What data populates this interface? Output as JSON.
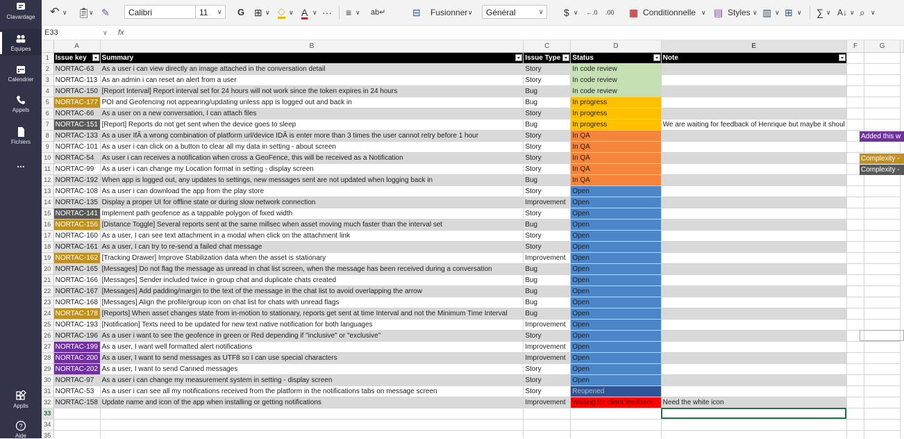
{
  "rail": {
    "items": [
      {
        "label": "Clavardage",
        "icon": "chat-icon"
      },
      {
        "label": "Équipes",
        "icon": "teams-icon"
      },
      {
        "label": "Calendrier",
        "icon": "calendar-icon"
      },
      {
        "label": "Appels",
        "icon": "phone-icon"
      },
      {
        "label": "Fichiers",
        "icon": "files-icon"
      },
      {
        "label": "...",
        "icon": "more-icon"
      },
      {
        "label": "Applis",
        "icon": "apps-icon"
      },
      {
        "label": "Aide",
        "icon": "help-icon"
      }
    ]
  },
  "ribbon": {
    "font_name": "Calibri",
    "font_size": "11",
    "bold": "G",
    "merge": "Fusionner",
    "number_format": "Général",
    "currency": "$",
    "dec_inc": "←.0",
    "dec_dec": ".00",
    "conditional": "Conditionnelle",
    "styles": "Styles",
    "more": "···"
  },
  "formula_bar": {
    "cell_ref": "E33",
    "fx": "fx",
    "value": ""
  },
  "columns": [
    "A",
    "B",
    "C",
    "D",
    "E",
    "F",
    "G"
  ],
  "header": {
    "key": "Issue key",
    "summary": "Summary",
    "type": "Issue Type",
    "status": "Status",
    "note": "Note"
  },
  "rows": [
    {
      "n": "2",
      "key": "NORTAC-63",
      "summary": " As a user i can view directly an image attached in the conversation detail",
      "type": "Story",
      "status": "In code review",
      "note": ""
    },
    {
      "n": "3",
      "key": "NORTAC-113",
      "summary": "As an admin i can reset an alert from a user",
      "type": "Story",
      "status": "In code review",
      "note": ""
    },
    {
      "n": "4",
      "key": "NORTAC-150",
      "summary": "[Report Interval] Report interval set for 24 hours will not work since the token expires in 24 hours",
      "type": "Bug",
      "status": "In code review",
      "note": ""
    },
    {
      "n": "5",
      "key": "NORTAC-177",
      "summary": "POI and Geofencing not appearing/updating unless app is logged out and back in",
      "type": "Bug",
      "status": "In progress",
      "note": ""
    },
    {
      "n": "6",
      "key": "NORTAC-66",
      "summary": "As a user on a new conversation, I can attach files",
      "type": "Story",
      "status": "In progress",
      "note": ""
    },
    {
      "n": "7",
      "key": "NORTAC-151",
      "summary": "[Report] Reports do not get sent when the device goes to sleep",
      "type": "Bug",
      "status": "In progress",
      "note": "We are waiting for feedback of Henrique but maybe it shoul"
    },
    {
      "n": "8",
      "key": "NORTAC-133",
      "summary": "As a user IfÂ a wrong combination of platform url/device IDÂ is enter more than 3 times the user cannot retry before 1 hour",
      "type": "Story",
      "status": "In QA",
      "note": ""
    },
    {
      "n": "9",
      "key": "NORTAC-101",
      "summary": "As a user i can click on a button to clear all my data in setting - about screen",
      "type": "Story",
      "status": "In QA",
      "note": ""
    },
    {
      "n": "10",
      "key": "NORTAC-54",
      "summary": "As user i can receives a notification when cross a GeoFence, this will be received as a Notification",
      "type": "Story",
      "status": "In QA",
      "note": ""
    },
    {
      "n": "11",
      "key": "NORTAC-99",
      "summary": "As a user i can change my Location format in setting - display screen",
      "type": "Story",
      "status": "In QA",
      "note": ""
    },
    {
      "n": "12",
      "key": "NORTAC-192",
      "summary": "When app is logged out, any updates to settings, new messages sent are not updated when logging back in",
      "type": "Bug",
      "status": "In QA",
      "note": ""
    },
    {
      "n": "13",
      "key": "NORTAC-108",
      "summary": "As a user i can download the app from the play store",
      "type": "Story",
      "status": "Open",
      "note": ""
    },
    {
      "n": "14",
      "key": "NORTAC-135",
      "summary": "Display a proper UI for offline state or during slow network connection",
      "type": "Improvement",
      "status": "Open",
      "note": ""
    },
    {
      "n": "15",
      "key": "NORTAC-141",
      "summary": "Implement path geofence as a tappable polygon of fixed width",
      "type": "Story",
      "status": "Open",
      "note": ""
    },
    {
      "n": "16",
      "key": "NORTAC-156",
      "summary": "[Distance Toggle] Several reports sent at the same millsec when asset moving much faster than the interval set",
      "type": "Bug",
      "status": "Open",
      "note": ""
    },
    {
      "n": "17",
      "key": "NORTAC-160",
      "summary": "As a user, I can see text attachment in a modal when click on the attachment link",
      "type": "Story",
      "status": "Open",
      "note": ""
    },
    {
      "n": "18",
      "key": "NORTAC-161",
      "summary": "As a user, I can try to re-send a failed chat message",
      "type": "Story",
      "status": "Open",
      "note": ""
    },
    {
      "n": "19",
      "key": "NORTAC-162",
      "summary": "[Tracking Drawer] Improve Stabilization data when the asset is stationary",
      "type": "Improvement",
      "status": "Open",
      "note": ""
    },
    {
      "n": "20",
      "key": "NORTAC-165",
      "summary": "[Messages] Do not flag the message as unread in chat list screen, when the message has been received during a conversation",
      "type": "Bug",
      "status": "Open",
      "note": ""
    },
    {
      "n": "21",
      "key": "NORTAC-166",
      "summary": "[Messages] Sender included twice in group chat and duplicate chats created",
      "type": "Bug",
      "status": "Open",
      "note": ""
    },
    {
      "n": "22",
      "key": "NORTAC-167",
      "summary": "[Messages] Add padding/margin to the text of the message in the chat list to avoid overlapping the arrow",
      "type": "Bug",
      "status": "Open",
      "note": ""
    },
    {
      "n": "23",
      "key": "NORTAC-168",
      "summary": "[Messages] Align the profile/group icon on chat list for chats with unread flags",
      "type": "Bug",
      "status": "Open",
      "note": ""
    },
    {
      "n": "24",
      "key": "NORTAC-178",
      "summary": "[Reports] When asset changes state from in-motion to stationary, reports get sent at time Interval and not the Minimum Time Interval",
      "type": "Bug",
      "status": "Open",
      "note": ""
    },
    {
      "n": "25",
      "key": "NORTAC-193",
      "summary": "[Notification] Texts need to be updated for new text native notification for both languages",
      "type": "Improvement",
      "status": "Open",
      "note": ""
    },
    {
      "n": "26",
      "key": "NORTAC-196",
      "summary": "As a user i want to see the geofence in green or Red depending if \"inclusive\" or \"exclusive\"",
      "type": "Story",
      "status": "Open",
      "note": ""
    },
    {
      "n": "27",
      "key": "NORTAC-199",
      "summary": "As a user, I want well formatted alert notifications",
      "type": "Improvement",
      "status": "Open",
      "note": ""
    },
    {
      "n": "28",
      "key": "NORTAC-200",
      "summary": "As a user, I want to send messages as UTF8 so I can use special characters",
      "type": "Improvement",
      "status": "Open",
      "note": ""
    },
    {
      "n": "29",
      "key": "NORTAC-202",
      "summary": "As a user, I want to send Canned messages",
      "type": "Story",
      "status": "Open",
      "note": ""
    },
    {
      "n": "30",
      "key": "NORTAC-97",
      "summary": "As a user i can change my measurement system in setting - display screen",
      "type": "Story",
      "status": "Open",
      "note": ""
    },
    {
      "n": "31",
      "key": "NORTAC-53",
      "summary": "As a user i can see all my notifications received from the platform in the notifications tabs on message screen",
      "type": "Story",
      "status": "Reopened",
      "note": ""
    },
    {
      "n": "32",
      "key": "NORTAC-158",
      "summary": "Update name and icon of the app when installing or getting notifications",
      "type": "Improvement",
      "status": "Waiting for client feedback",
      "note": "Need the white icon"
    }
  ],
  "empty_rows": [
    "33",
    "34",
    "35"
  ],
  "side_notes": {
    "added": "Added this w",
    "complexity1": "Complexity -",
    "complexity2": "Complexity -"
  },
  "colors": {
    "in_code_review": "#c6e0b4",
    "in_progress": "#ffc000",
    "in_qa": "#f4853b",
    "open": "#4a86c8",
    "reopened": "#2f5597",
    "waiting": "#ff0000",
    "key_brown": "#c09020",
    "key_dark": "#595959",
    "key_purple": "#7030a0",
    "rail": "#33344a"
  }
}
